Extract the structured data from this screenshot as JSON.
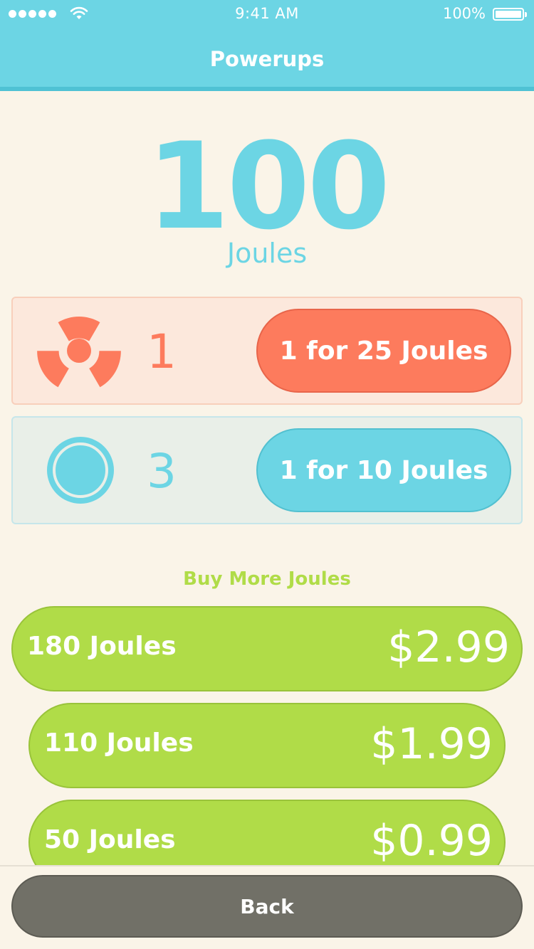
{
  "status_bar": {
    "time": "9:41 AM",
    "battery": "100%",
    "battery_level": 1.0
  },
  "nav": {
    "title": "Powerups"
  },
  "balance": {
    "value": "100",
    "unit": "Joules"
  },
  "powerups": [
    {
      "icon": "radiation-icon",
      "count": "1",
      "buy_label": "1 for 25 Joules",
      "color": "#fd7b5d"
    },
    {
      "icon": "shield-ring-icon",
      "count": "3",
      "buy_label": "1 for 10 Joules",
      "color": "#6cd5e4"
    }
  ],
  "store": {
    "heading": "Buy More Joules",
    "packages": [
      {
        "name": "180 Joules",
        "price": "$2.99"
      },
      {
        "name": "110 Joules",
        "price": "$1.99"
      },
      {
        "name": "50 Joules",
        "price": "$0.99"
      }
    ]
  },
  "footer": {
    "back_label": "Back"
  },
  "colors": {
    "accent_blue": "#6cd5e4",
    "accent_red": "#fd7b5d",
    "accent_green": "#b0dc48",
    "button_gray": "#717067",
    "background": "#faf4e8"
  }
}
